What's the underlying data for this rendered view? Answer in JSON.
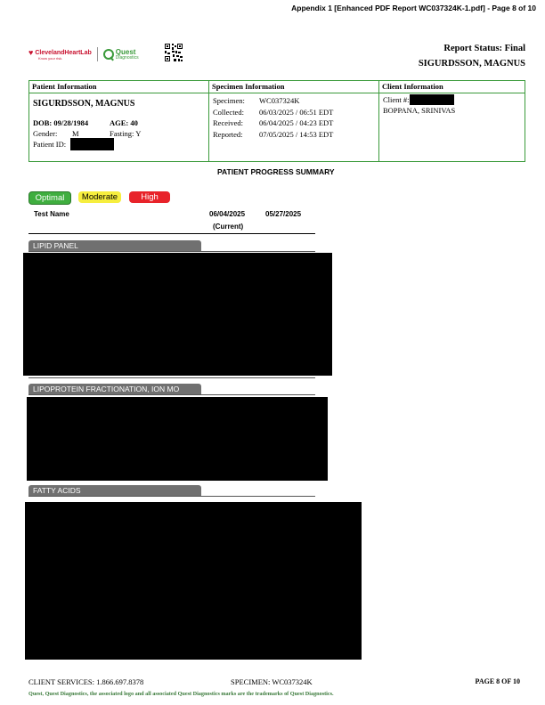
{
  "header": {
    "appendix": "Appendix 1 [Enhanced PDF Report WC037324K-1.pdf] - Page 8 of 10",
    "report_status": "Report Status: Final",
    "patient_name_header": "SIGURDSSON, MAGNUS",
    "logos": {
      "cleveland": "ClevelandHeartLab",
      "cleveland_tag": "Know your risk.",
      "quest": "Quest",
      "quest_sub": "Diagnostics"
    }
  },
  "patient_info": {
    "heading": "Patient Information",
    "name": "SIGURDSSON, MAGNUS",
    "dob": "DOB: 09/28/1984",
    "age": "AGE: 40",
    "gender_label": "Gender:",
    "gender": "M",
    "fasting": "Fasting: Y",
    "patient_id_label": "Patient ID:"
  },
  "specimen_info": {
    "heading": "Specimen Information",
    "rows": [
      {
        "label": "Specimen:",
        "value": "WC037324K"
      },
      {
        "label": "Collected:",
        "value": "06/03/2025  / 06:51 EDT"
      },
      {
        "label": "Received:",
        "value": "06/04/2025  / 04:23 EDT"
      },
      {
        "label": "Reported:",
        "value": "07/05/2025  / 14:53 EDT"
      }
    ]
  },
  "client_info": {
    "heading": "Client Information",
    "client_label": "Client #:",
    "physician": "BOPPANA, SRINIVAS"
  },
  "summary": {
    "title": "PATIENT PROGRESS SUMMARY",
    "legend": {
      "optimal": "Optimal",
      "moderate": "Moderate",
      "high": "High"
    },
    "colors": {
      "optimal": "#3fae3f",
      "moderate": "#f6ee3e",
      "high": "#e8232a"
    },
    "columns": {
      "test_name": "Test Name",
      "date1": "06/04/2025",
      "date1_sub": "(Current)",
      "date2": "05/27/2025"
    },
    "sections": [
      "LIPID PANEL",
      "LIPOPROTEIN FRACTIONATION, ION MO",
      "FATTY ACIDS"
    ]
  },
  "footer": {
    "client_services": "CLIENT SERVICES: 1.866.697.8378",
    "specimen": "SPECIMEN: WC037324K",
    "page": "PAGE 8 OF 10",
    "trademark": "Quest, Quest Diagnostics, the associated logo and all associated Quest Diagnostics marks are the trademarks of Quest Diagnostics."
  }
}
